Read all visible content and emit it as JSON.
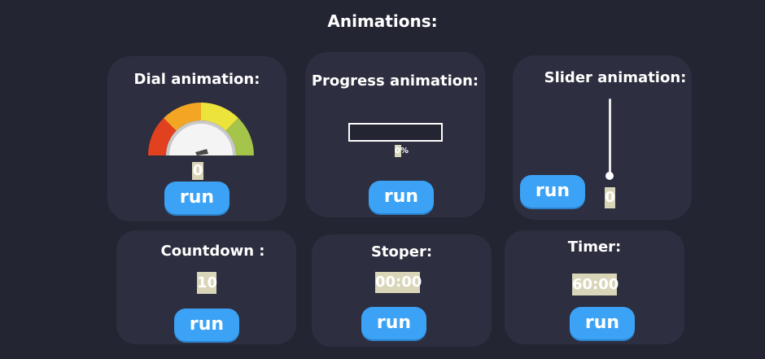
{
  "page_title": "Animations:",
  "dial": {
    "title": "Dial animation:",
    "value": "0",
    "run_label": "run",
    "colors": [
      "#e2411f",
      "#f2a623",
      "#ece43a",
      "#a4c44a"
    ]
  },
  "progress": {
    "title": "Progress animation:",
    "value_label": "0%",
    "progress_fraction": 0,
    "run_label": "run"
  },
  "slider": {
    "title": "Slider animation:",
    "value": "0",
    "level_fraction": 0,
    "run_label": "run"
  },
  "countdown": {
    "title": "Countdown :",
    "value": "10",
    "run_label": "run"
  },
  "stoper": {
    "title": "Stoper:",
    "value": "00:00",
    "run_label": "run"
  },
  "timer": {
    "title": "Timer:",
    "value": "60:00",
    "run_label": "run"
  },
  "colors": {
    "background": "#242533",
    "card": "#2d2e3f",
    "accent": "#3ba2f6",
    "value_box": "#d8d5b8"
  }
}
